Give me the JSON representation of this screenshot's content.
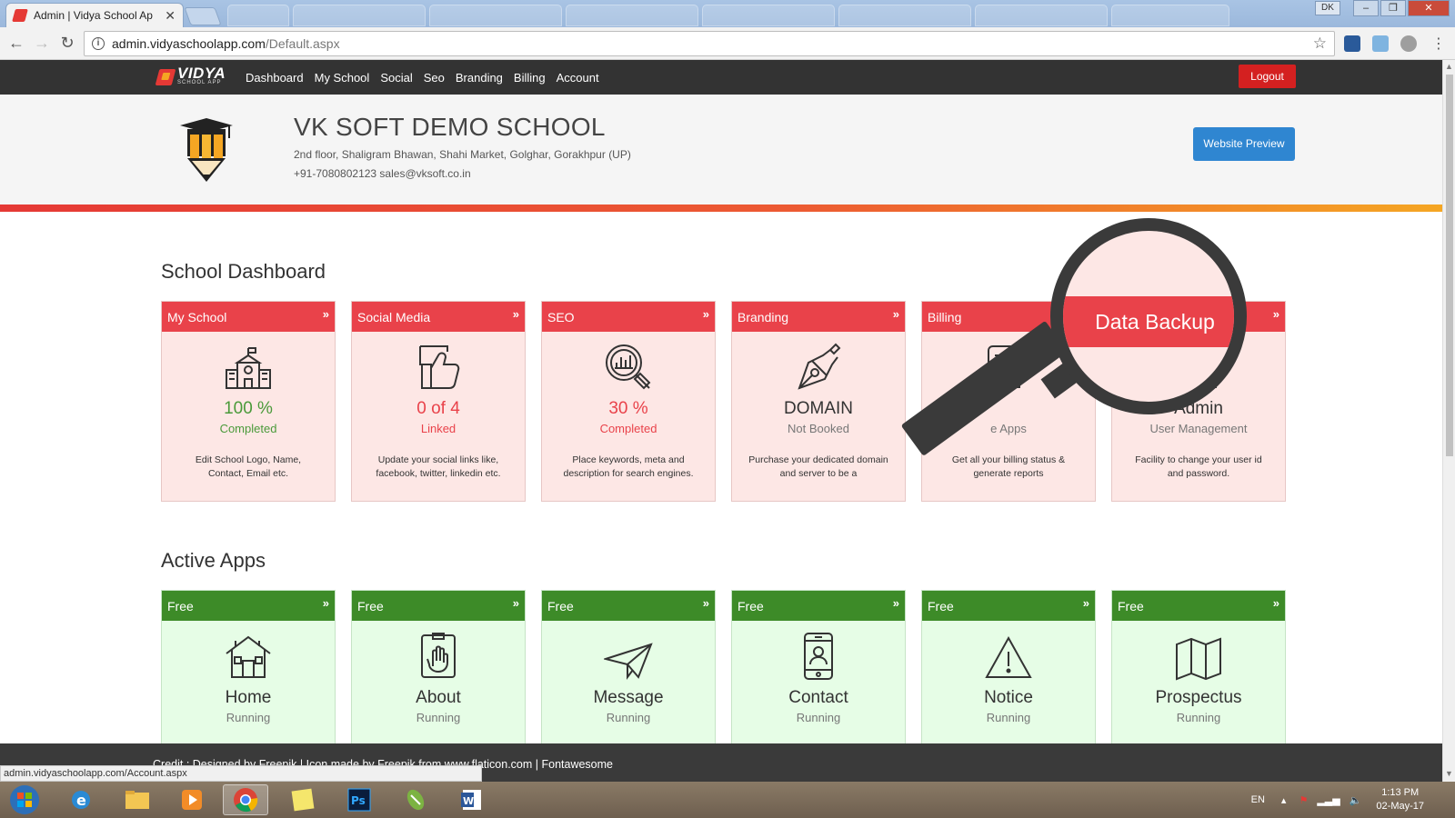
{
  "browser": {
    "tab_title": "Admin | Vidya School Ap",
    "tab_close": "✕",
    "url_host": "admin.vidyaschoolapp.com",
    "url_path": "/Default.aspx",
    "user_badge": "DK",
    "status_url": "admin.vidyaschoolapp.com/Account.aspx"
  },
  "nav": {
    "brand_name": "VIDYA",
    "brand_sub": "SCHOOL APP",
    "links": [
      "Dashboard",
      "My School",
      "Social",
      "Seo",
      "Branding",
      "Billing",
      "Account"
    ],
    "logout": "Logout"
  },
  "school": {
    "name": "VK SOFT DEMO SCHOOL",
    "address": "2nd floor, Shaligram Bhawan, Shahi Market, Golghar, Gorakhpur (UP)",
    "contact": "+91-7080802123  sales@vksoft.co.in",
    "preview_button": "Website Preview"
  },
  "dashboard": {
    "title": "School Dashboard",
    "cards": [
      {
        "head": "My School",
        "main": "100 %",
        "sub": "Completed",
        "desc": "Edit School Logo, Name, Contact, Email etc.",
        "icon": "school-building-icon"
      },
      {
        "head": "Social Media",
        "main": "0 of 4",
        "sub": "Linked",
        "desc": "Update your social links like, facebook, twitter, linkedin etc.",
        "icon": "thumbs-up-icon"
      },
      {
        "head": "SEO",
        "main": "30 %",
        "sub": "Completed",
        "desc": "Place keywords, meta and description for search engines.",
        "icon": "seo-magnifier-icon"
      },
      {
        "head": "Branding",
        "main": "DOMAIN",
        "sub": "Not Booked",
        "desc": "Purchase your dedicated domain and server to be a",
        "icon": "pen-nib-icon"
      },
      {
        "head": "Billing",
        "main": "",
        "sub": "e Apps",
        "desc": "Get all your billing status & generate reports",
        "icon": "invoice-icon"
      },
      {
        "head": "",
        "main": "Admin",
        "sub": "User Management",
        "desc": "Facility to change your user id and password.",
        "icon": "user-admin-icon"
      }
    ]
  },
  "apps": {
    "title": "Active Apps",
    "cards": [
      {
        "head": "Free",
        "main": "Home",
        "sub": "Running",
        "icon": "home-icon"
      },
      {
        "head": "Free",
        "main": "About",
        "sub": "Running",
        "icon": "hand-document-icon"
      },
      {
        "head": "Free",
        "main": "Message",
        "sub": "Running",
        "icon": "paper-plane-icon"
      },
      {
        "head": "Free",
        "main": "Contact",
        "sub": "Running",
        "icon": "phone-contact-icon"
      },
      {
        "head": "Free",
        "main": "Notice",
        "sub": "Running",
        "icon": "warning-icon"
      },
      {
        "head": "Free",
        "main": "Prospectus",
        "sub": "Running",
        "icon": "map-book-icon"
      }
    ]
  },
  "callout": {
    "label": "Data Backup"
  },
  "footer": {
    "credit": "Credit : Designed by Freepik | Icon made by Freepik from www.flaticon.com | Fontawesome"
  },
  "taskbar": {
    "lang": "EN",
    "time": "1:13 PM",
    "date": "02-May-17"
  },
  "colors": {
    "red": "#e9424a",
    "green": "#3d8b28",
    "blue": "#2f86d1",
    "nav": "#333333"
  }
}
